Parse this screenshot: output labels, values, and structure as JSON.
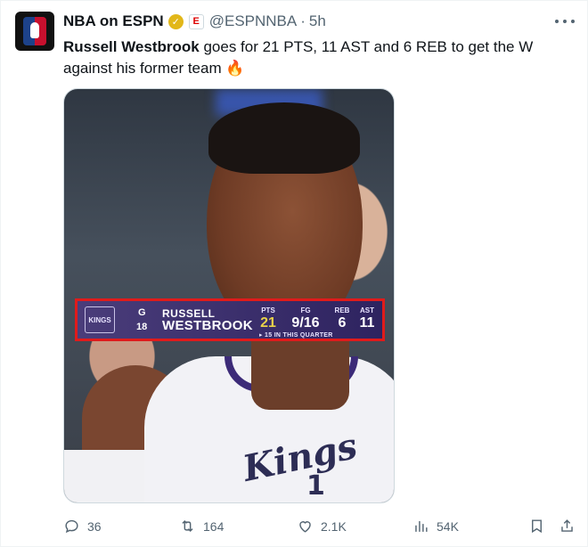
{
  "account": {
    "name": "NBA on ESPN",
    "handle": "@ESPNNBA",
    "separator": "·",
    "time": "5h",
    "verified": "✓",
    "brand_mark": "E"
  },
  "tweet": {
    "player": "Russell Westbrook",
    "body": " goes for 21 PTS, 11 AST and 6 REB to get the W against his former team ",
    "emoji": "🔥"
  },
  "scorebug": {
    "team_logo_text": "KINGS",
    "position": "G",
    "jersey_number": "18",
    "first_name": "RUSSELL",
    "last_name": "WESTBROOK",
    "stats": [
      {
        "label": "PTS",
        "value": "21"
      },
      {
        "label": "FG",
        "value": "9/16"
      },
      {
        "label": "REB",
        "value": "6"
      },
      {
        "label": "AST",
        "value": "11"
      }
    ],
    "note": "▸ 15 IN THIS QUARTER"
  },
  "jersey": {
    "wordmark": "Kings",
    "number": "1"
  },
  "actions": {
    "replies": "36",
    "reposts": "164",
    "likes": "2.1K",
    "views": "54K"
  },
  "icons": [
    "more-icon",
    "reply-icon",
    "repost-icon",
    "like-icon",
    "views-icon",
    "bookmark-icon",
    "share-icon"
  ],
  "colors": {
    "accent": "#1d9bf0",
    "muted": "#536471",
    "scorebar": "#2e2360",
    "highlight": "#e01b1b",
    "pts": "#e9d24a"
  }
}
